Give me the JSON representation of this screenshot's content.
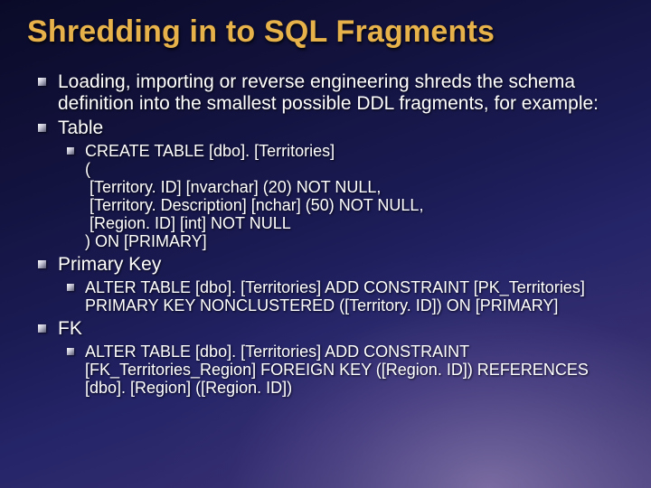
{
  "title": "Shredding in to SQL Fragments",
  "bullets": {
    "intro": "Loading, importing or reverse engineering shreds the schema definition into the smallest possible DDL fragments, for example:",
    "table_label": "Table",
    "table_code": "CREATE TABLE [dbo]. [Territories]\n(\n [Territory. ID] [nvarchar] (20) NOT NULL,\n [Territory. Description] [nchar] (50) NOT NULL,\n [Region. ID] [int] NOT NULL\n) ON [PRIMARY]",
    "pk_label": "Primary Key",
    "pk_code": "ALTER TABLE [dbo]. [Territories] ADD CONSTRAINT [PK_Territories] PRIMARY KEY NONCLUSTERED  ([Territory. ID]) ON [PRIMARY]",
    "fk_label": "FK",
    "fk_code": "ALTER TABLE [dbo]. [Territories] ADD CONSTRAINT [FK_Territories_Region] FOREIGN KEY ([Region. ID]) REFERENCES [dbo]. [Region] ([Region. ID])"
  }
}
